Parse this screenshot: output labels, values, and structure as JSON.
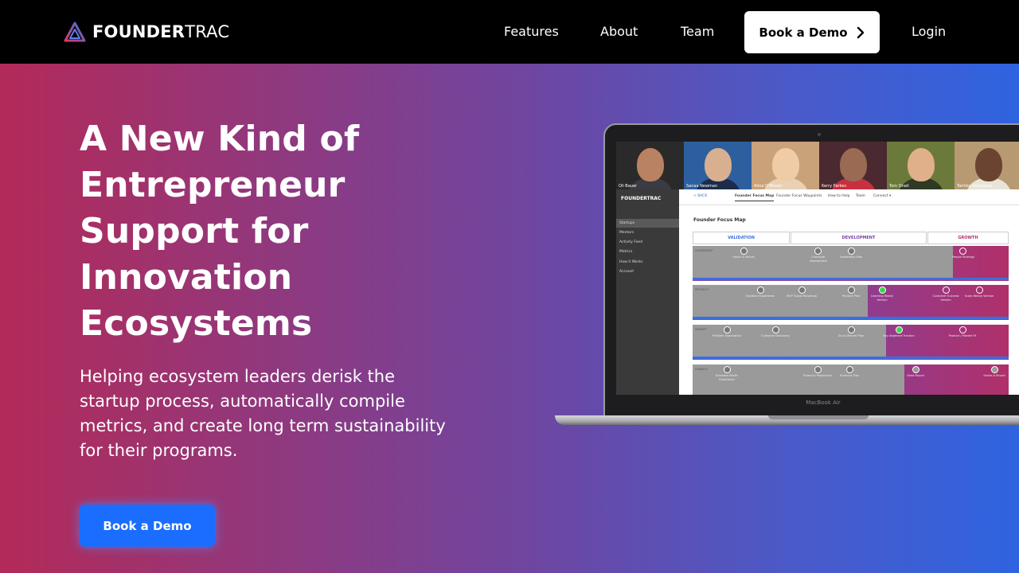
{
  "nav": {
    "logo_bold": "FOUNDER",
    "logo_light": "TRAC",
    "links": [
      {
        "label": "Features"
      },
      {
        "label": "About"
      },
      {
        "label": "Team"
      }
    ],
    "cta_label": "Book a Demo",
    "login_label": "Login"
  },
  "hero": {
    "title_lines": [
      "A New Kind of",
      "Entrepreneur",
      "Support for",
      "Innovation",
      "Ecosystems"
    ],
    "subtitle": "Helping ecosystem leaders derisk the startup process, automatically compile metrics, and create long term sustainability for their programs.",
    "cta_label": "Book a Demo"
  },
  "laptop": {
    "model_label": "MacBook Air",
    "people": [
      {
        "name": "Oli Bauer"
      },
      {
        "name": "Sanaa Newman"
      },
      {
        "name": "Alina O'Moore"
      },
      {
        "name": "Kerry Parkes"
      },
      {
        "name": "Tom Oneil"
      },
      {
        "name": "Tamika Velazquez"
      }
    ],
    "app": {
      "logo": "FOUNDERTRAC",
      "sidebar": [
        "Startups",
        "Mentors",
        "Activity Feed",
        "Metrics",
        "How it Works",
        "Account"
      ],
      "tabs": [
        "< BACK",
        "Founder Focus Map",
        "Founder Focus Waypoints",
        "How to Help",
        "Team",
        "Connect ▾"
      ],
      "map_title": "Founder Focus Map",
      "phases": [
        "VALIDATION",
        "DEVELOPMENT",
        "GROWTH"
      ],
      "rows": [
        {
          "label": "LEADERSHIP",
          "nodes": [
            "Vision & Values",
            "Character Assessment",
            "Leadership Plan",
            "People Strategy"
          ]
        },
        {
          "label": "PRODUCT",
          "nodes": [
            "Solution Hypothesis",
            "MVP Scope Roadmap",
            "Product Plan",
            "Learning Ready Version",
            "Customer Success Version",
            "Scale-Ready Version"
          ]
        },
        {
          "label": "MARKET",
          "nodes": [
            "Problem Exploration",
            "Customer Discovery",
            "Go-to-Market Plan",
            "Key-Segment Traction",
            "Product / Market Fit"
          ]
        },
        {
          "label": "FINANCE",
          "nodes": [
            "Business Model Hypothesis",
            "Financial Projections",
            "Financial Plan",
            "Seed Round",
            "Series A Round"
          ]
        }
      ]
    }
  },
  "colors": {
    "nav_bg": "#000000",
    "cta_blue": "#1a6dff",
    "gradient_left": "#b32a58",
    "gradient_right": "#2f63e0"
  }
}
